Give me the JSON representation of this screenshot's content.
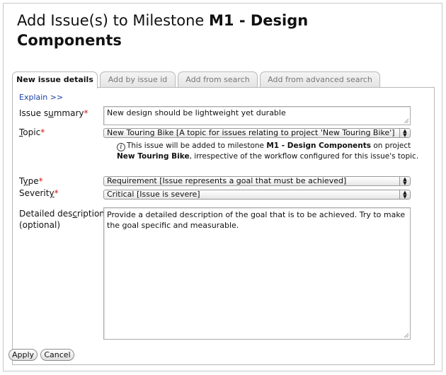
{
  "page_title": {
    "prefix": "Add Issue(s) to Milestone ",
    "milestone": "M1 - Design Components"
  },
  "tabs": [
    {
      "label": "New issue details",
      "active": true
    },
    {
      "label": "Add by issue id",
      "active": false
    },
    {
      "label": "Add from search",
      "active": false
    },
    {
      "label": "Add from advanced search",
      "active": false
    }
  ],
  "explain_link": "Explain >>",
  "form": {
    "summary": {
      "label_pre": "Issue s",
      "label_access": "u",
      "label_post": "mmary",
      "required_mark": "*",
      "value": "New design should be lightweight yet durable"
    },
    "topic": {
      "label_pre": "",
      "label_access": "T",
      "label_post": "opic",
      "required_mark": "*",
      "value": "New Touring Bike [A topic for issues relating to project 'New Touring Bike']"
    },
    "note": {
      "icon": "i",
      "text1": "This issue will be added to milestone ",
      "milestone": "M1 - Design Components",
      "text2": " on project ",
      "project": "New Touring Bike",
      "text3": ", irrespective of the workflow configured for this issue's topic."
    },
    "type": {
      "label_pre": "T",
      "label_access": "y",
      "label_post": "pe",
      "required_mark": "*",
      "value": "Requirement [Issue represents a goal that must be achieved]"
    },
    "severity": {
      "label_pre": "Severit",
      "label_access": "y",
      "label_post": "",
      "required_mark": "*",
      "value": "Critical [Issue is severe]"
    },
    "description": {
      "label_pre": "Detailed des",
      "label_access": "c",
      "label_post": "ription",
      "label_line2": "(optional)",
      "value": "Provide a detailed description of the goal that is to be achieved. Try to make the goal specific and measurable."
    }
  },
  "buttons": {
    "apply": "Apply",
    "cancel": "Cancel"
  },
  "icons": {
    "select_arrows": "up-down-arrows",
    "info": "info-circle",
    "resize": "resize-grip"
  },
  "colors": {
    "link": "#1a3ea8",
    "required": "#d01818"
  }
}
